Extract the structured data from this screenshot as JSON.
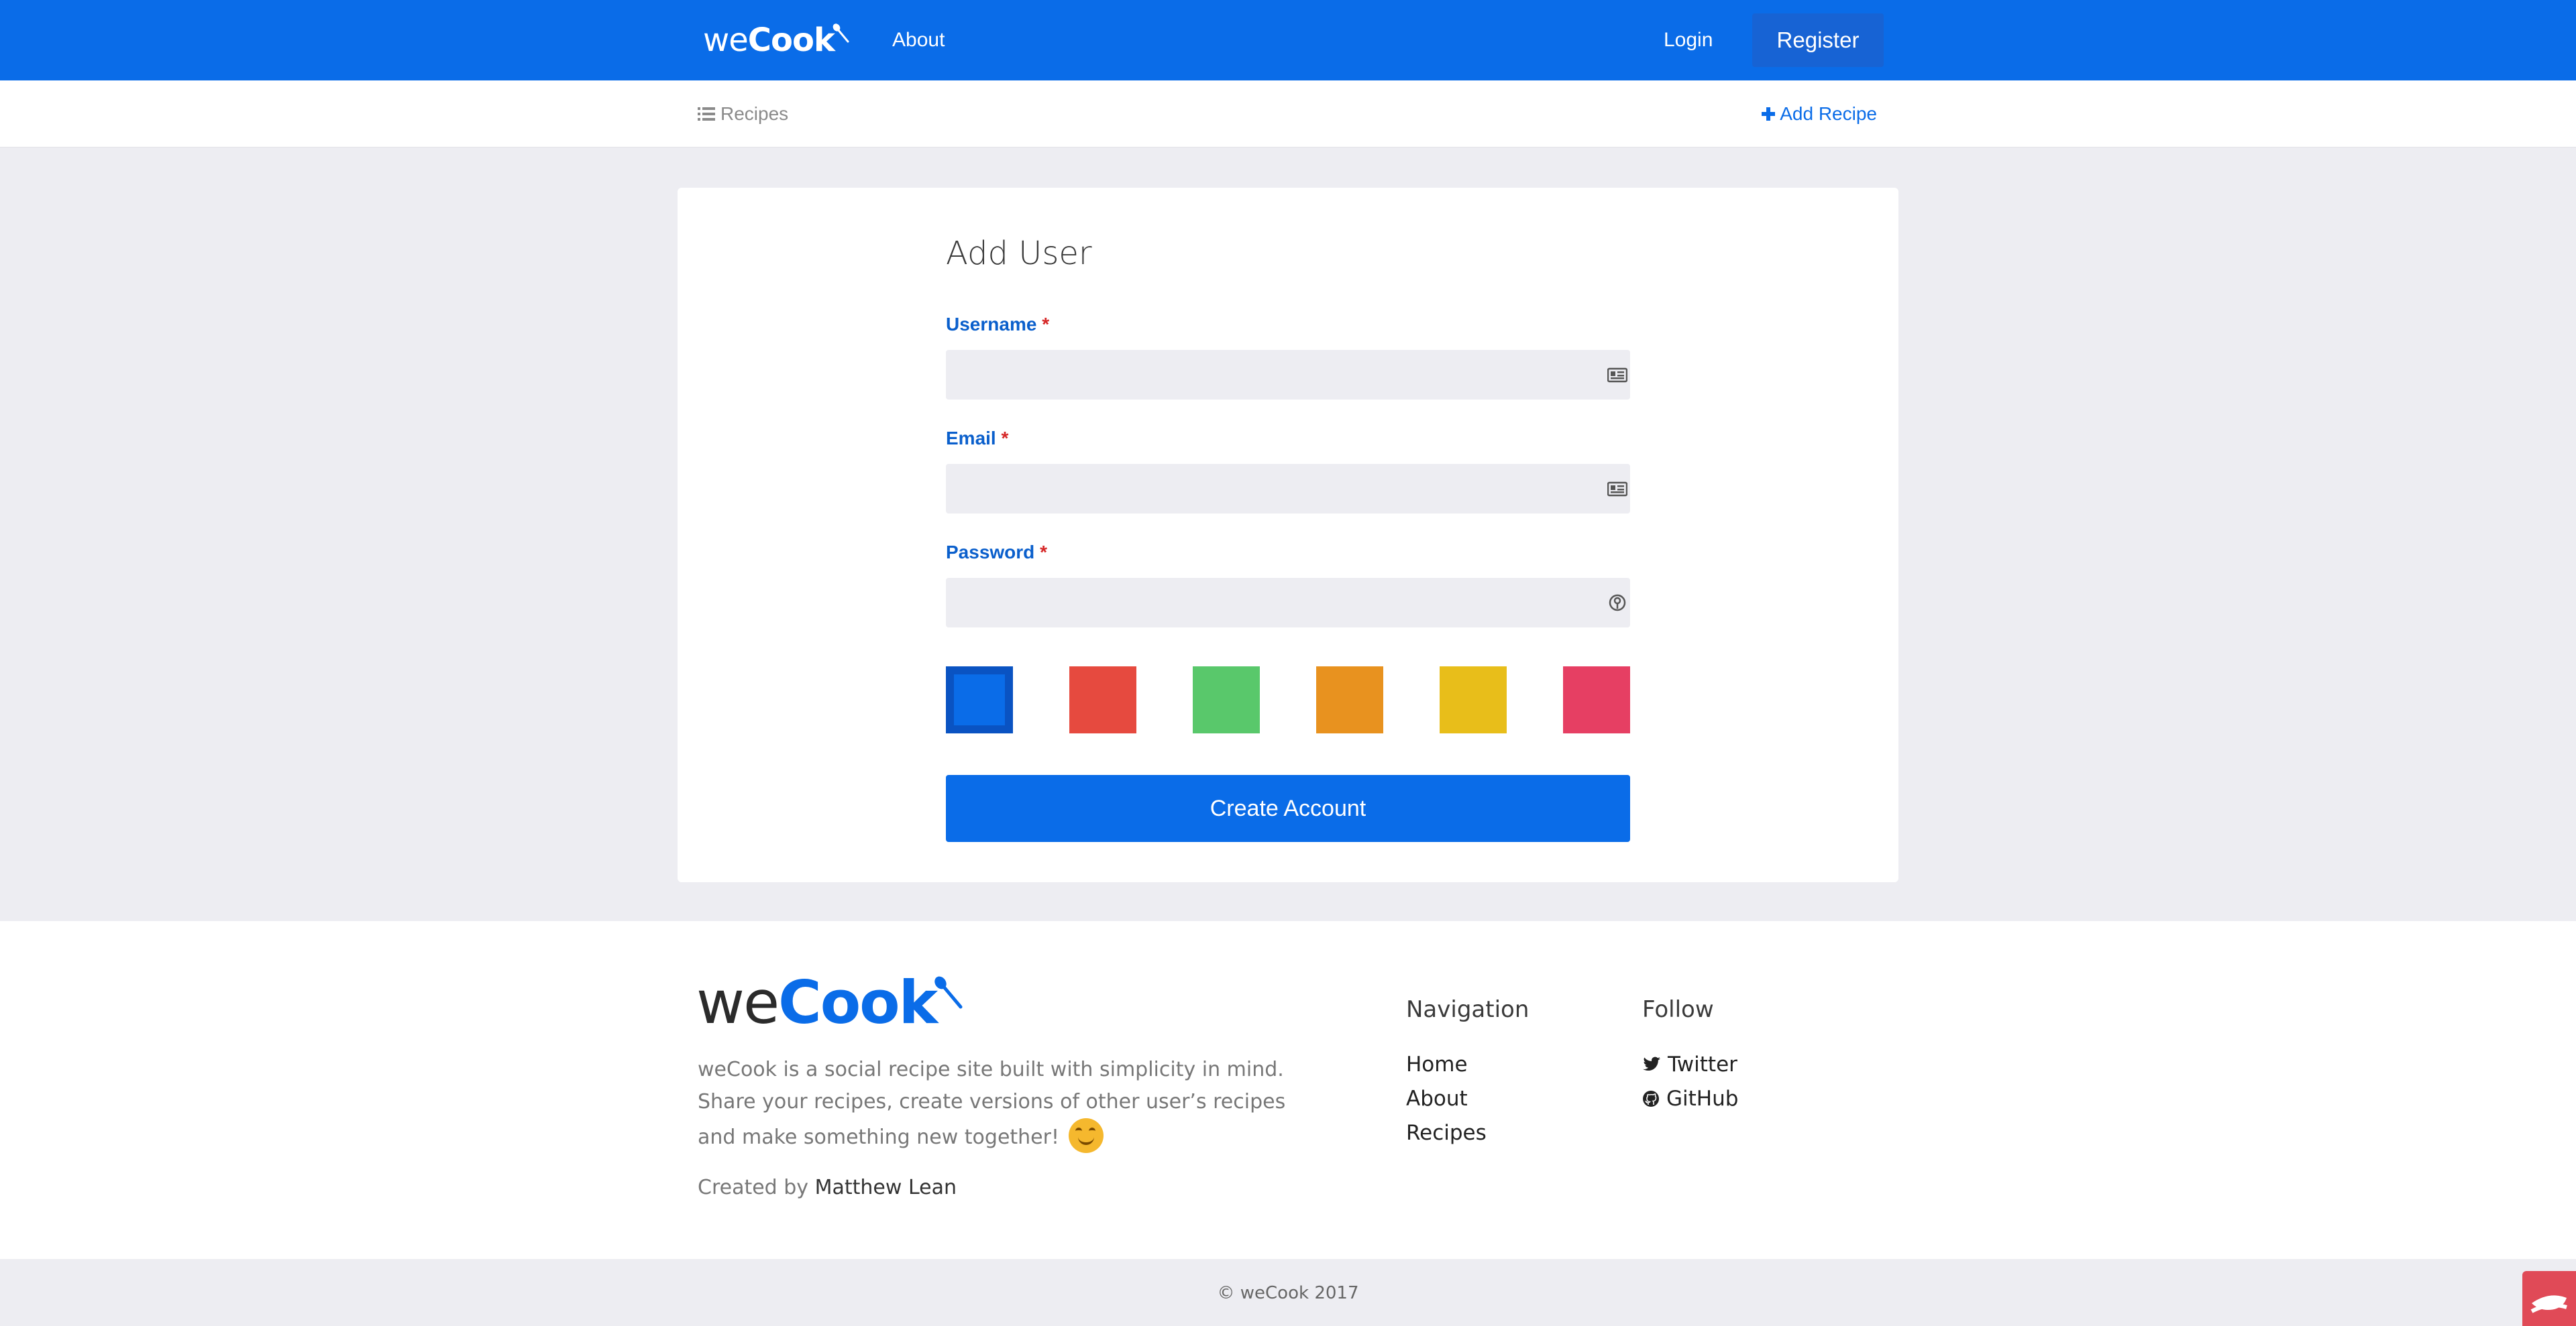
{
  "navbar": {
    "brand_we": "we",
    "brand_cook": "Cook",
    "about": "About",
    "login": "Login",
    "register": "Register"
  },
  "subnav": {
    "recipes": "Recipes",
    "add_recipe": "Add Recipe"
  },
  "form": {
    "title": "Add User",
    "username_label": "Username",
    "email_label": "Email",
    "password_label": "Password",
    "required_mark": "*",
    "username_value": "",
    "email_value": "",
    "password_value": "",
    "colors": [
      "#0a6ce8",
      "#e64a3f",
      "#59c86b",
      "#e8921f",
      "#e8be1a",
      "#e63f63"
    ],
    "selected_color": "#0a6ce8",
    "submit": "Create Account"
  },
  "footer": {
    "logo_we": "we",
    "logo_cook": "Cook",
    "description": "weCook is a social recipe site built with simplicity in mind. Share your recipes, create versions of other user’s recipes and make something new together!",
    "created_prefix": "Created by",
    "created_name": "Matthew Lean",
    "navigation_heading": "Navigation",
    "navigation_links": [
      "Home",
      "About",
      "Recipes"
    ],
    "follow_heading": "Follow",
    "follow_links": [
      "Twitter",
      "GitHub"
    ],
    "copyright": "© weCook 2017"
  },
  "theme": {
    "primary": "#0a6ce8",
    "background": "#ededf2",
    "required": "#d62828"
  }
}
